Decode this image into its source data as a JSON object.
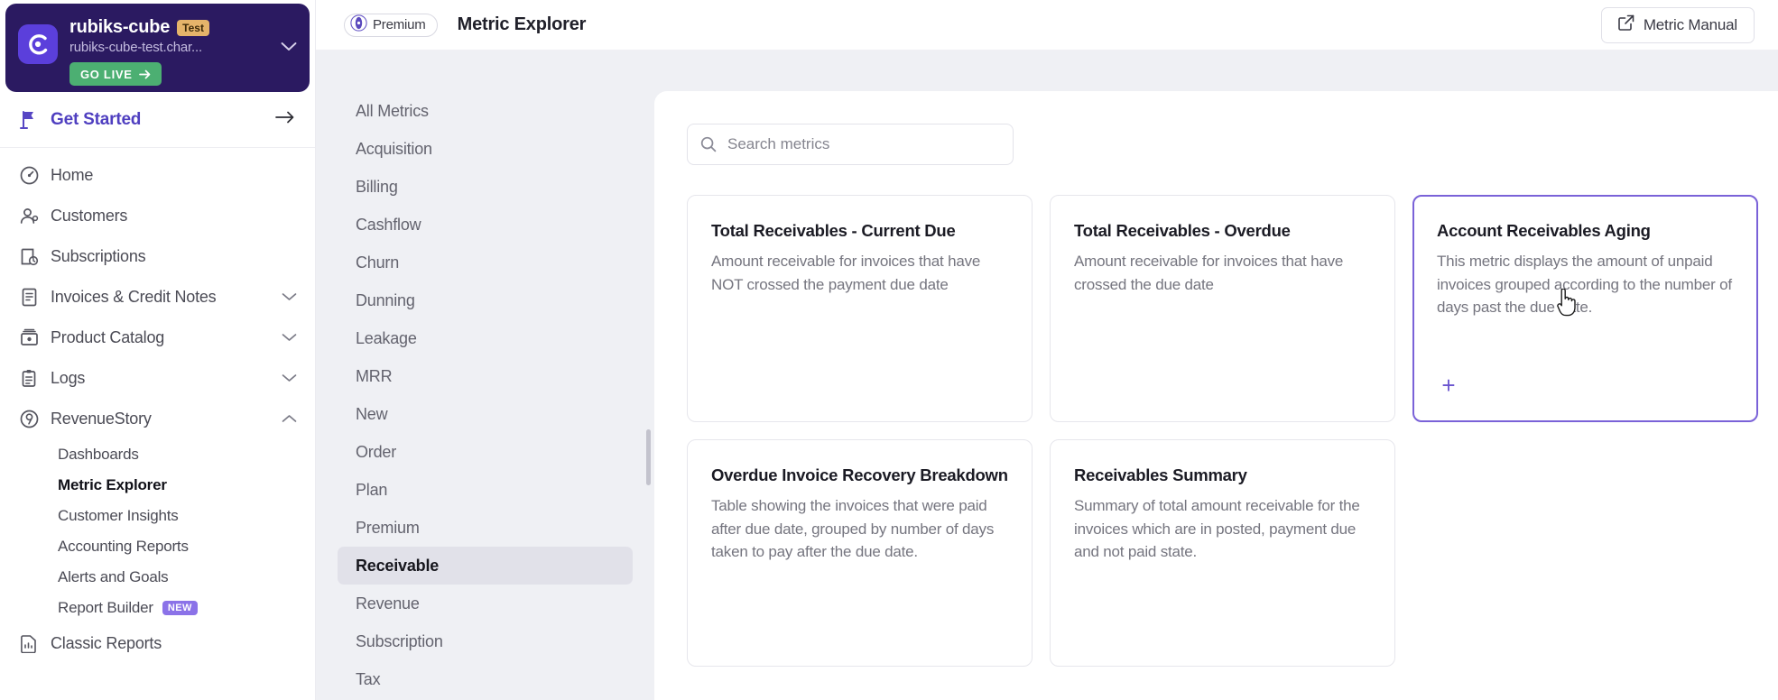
{
  "org": {
    "name": "rubiks-cube",
    "badge": "Test",
    "domain": "rubiks-cube-test.char...",
    "go_live_label": "GO LIVE",
    "logo_icon": "chargebee-logo-icon",
    "chevron_icon": "chevron-down-icon",
    "brand_color": "#2b1a61",
    "logo_color": "#5b3fdb",
    "go_live_color": "#4caf72",
    "badge_color": "#e5b46a"
  },
  "get_started": {
    "label": "Get Started",
    "icon": "flag-icon",
    "arrow_icon": "arrow-right-icon",
    "accent_color": "#4f3fc0"
  },
  "sidebar": {
    "items": [
      {
        "label": "Home",
        "icon": "gauge-icon",
        "expandable": false
      },
      {
        "label": "Customers",
        "icon": "user-icon",
        "expandable": false
      },
      {
        "label": "Subscriptions",
        "icon": "calendar-clock-icon",
        "expandable": false
      },
      {
        "label": "Invoices & Credit Notes",
        "icon": "invoice-icon",
        "expandable": true
      },
      {
        "label": "Product Catalog",
        "icon": "catalog-icon",
        "expandable": true
      },
      {
        "label": "Logs",
        "icon": "clipboard-icon",
        "expandable": true
      },
      {
        "label": "RevenueStory",
        "icon": "revenue-icon",
        "expandable": true,
        "expanded": true
      }
    ],
    "revenuestory_children": [
      {
        "label": "Dashboards",
        "active": false
      },
      {
        "label": "Metric Explorer",
        "active": true
      },
      {
        "label": "Customer Insights",
        "active": false
      },
      {
        "label": "Accounting Reports",
        "active": false
      },
      {
        "label": "Alerts and Goals",
        "active": false
      },
      {
        "label": "Report Builder",
        "active": false,
        "badge": "NEW"
      }
    ],
    "classic_reports": {
      "label": "Classic Reports",
      "icon": "report-icon"
    }
  },
  "topbar": {
    "premium_label": "Premium",
    "premium_icon": "premium-badge-icon",
    "page_title": "Metric Explorer",
    "manual_label": "Metric Manual",
    "manual_icon": "external-link-icon"
  },
  "search": {
    "placeholder": "Search metrics",
    "value": "",
    "icon": "search-icon"
  },
  "categories": [
    {
      "label": "All Metrics",
      "active": false
    },
    {
      "label": "Acquisition",
      "active": false
    },
    {
      "label": "Billing",
      "active": false
    },
    {
      "label": "Cashflow",
      "active": false
    },
    {
      "label": "Churn",
      "active": false
    },
    {
      "label": "Dunning",
      "active": false
    },
    {
      "label": "Leakage",
      "active": false
    },
    {
      "label": "MRR",
      "active": false
    },
    {
      "label": "New",
      "active": false
    },
    {
      "label": "Order",
      "active": false
    },
    {
      "label": "Plan",
      "active": false
    },
    {
      "label": "Premium",
      "active": false
    },
    {
      "label": "Receivable",
      "active": true
    },
    {
      "label": "Revenue",
      "active": false
    },
    {
      "label": "Subscription",
      "active": false
    },
    {
      "label": "Tax",
      "active": false
    }
  ],
  "metric_cards": [
    {
      "title": "Total Receivables - Current Due",
      "description": "Amount receivable for invoices that have NOT crossed the payment due date",
      "selected": false
    },
    {
      "title": "Total Receivables - Overdue",
      "description": "Amount receivable for invoices that have crossed the due date",
      "selected": false
    },
    {
      "title": "Account Receivables Aging",
      "description": "This metric displays the amount of unpaid invoices grouped according to the number of days past the due date.",
      "selected": true,
      "add_label": "+",
      "accent_color": "#7a62d8"
    },
    {
      "title": "Overdue Invoice Recovery Breakdown",
      "description": "Table showing the invoices that were paid after due date, grouped by number of days taken to pay after the due date.",
      "selected": false
    },
    {
      "title": "Receivables Summary",
      "description": "Summary of total amount receivable for the invoices which are in posted, payment due and not paid state.",
      "selected": false
    }
  ]
}
